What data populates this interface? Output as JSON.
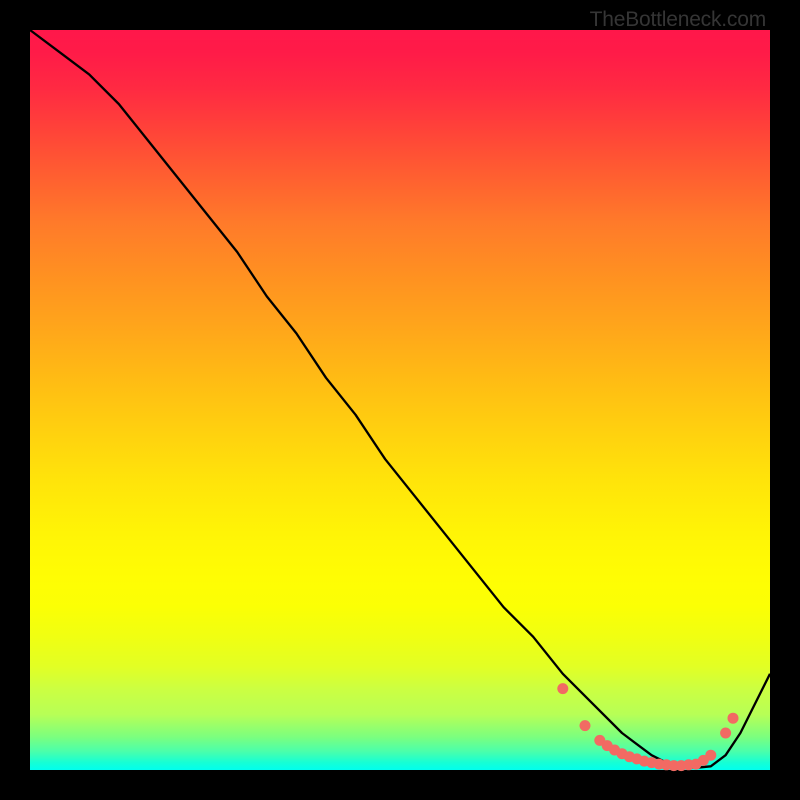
{
  "attribution": "TheBottleneck.com",
  "chart_data": {
    "type": "line",
    "title": "",
    "xlabel": "",
    "ylabel": "",
    "xlim": [
      0,
      100
    ],
    "ylim": [
      0,
      100
    ],
    "series": [
      {
        "name": "curve",
        "x": [
          0,
          4,
          8,
          12,
          16,
          20,
          24,
          28,
          32,
          36,
          40,
          44,
          48,
          52,
          56,
          60,
          64,
          68,
          72,
          76,
          80,
          84,
          86,
          88,
          90,
          92,
          94,
          96,
          98,
          100
        ],
        "y": [
          100,
          97,
          94,
          90,
          85,
          80,
          75,
          70,
          64,
          59,
          53,
          48,
          42,
          37,
          32,
          27,
          22,
          18,
          13,
          9,
          5,
          2,
          1,
          0.5,
          0.3,
          0.5,
          2,
          5,
          9,
          13
        ]
      }
    ],
    "markers": {
      "name": "dots",
      "color": "#f26a63",
      "x": [
        72,
        75,
        77,
        78,
        79,
        80,
        81,
        82,
        83,
        84,
        85,
        86,
        87,
        88,
        89,
        90,
        91,
        92,
        94,
        95
      ],
      "y": [
        11,
        6,
        4,
        3.3,
        2.7,
        2.2,
        1.8,
        1.5,
        1.2,
        1.0,
        0.8,
        0.7,
        0.6,
        0.6,
        0.7,
        0.8,
        1.3,
        2.0,
        5.0,
        7.0
      ]
    },
    "background_gradient": {
      "top": "#ff174a",
      "bottom": "#00ffee"
    }
  }
}
